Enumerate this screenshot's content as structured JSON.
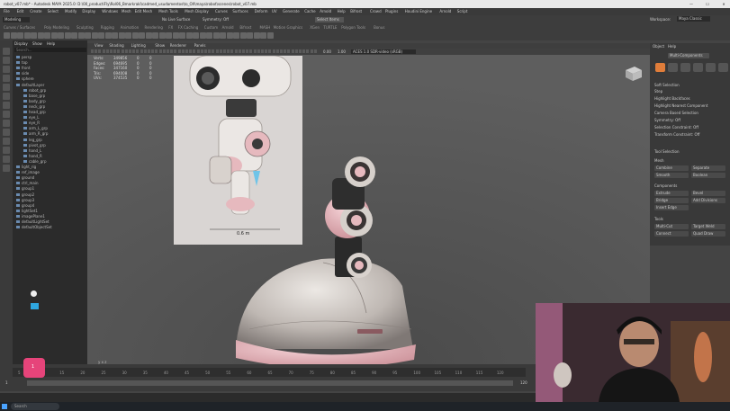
{
  "window": {
    "title": "robot_v07.mb* - Autodesk MAYA 2025.0: D:\\00_productiFly\\Rol06_Bmarkrakl\\cadmed_usudamentos\\to_OX\\maya\\robot\\scenes\\robot_v07.mb",
    "controls": [
      "—",
      "☐",
      "✕"
    ]
  },
  "menubar": {
    "items": [
      "File",
      "Edit",
      "Create",
      "Select",
      "Modify",
      "Display",
      "Windows",
      "Mesh",
      "Edit Mesh",
      "Mesh Tools",
      "Mesh Display",
      "Curves",
      "Surfaces",
      "Deform",
      "UV",
      "Generate",
      "Cache",
      "Arnold",
      "Help",
      "Bifrost",
      "Crowd",
      "Plugins",
      "Houdini Engine",
      "Arnold",
      "Script"
    ]
  },
  "shelf": {
    "modeling_dropdown": "Modeling",
    "workspace_label": "Workspace:",
    "workspace_value": "Maya Classic",
    "tabs": [
      "Curves / Surfaces",
      "Poly Modeling",
      "Sculpting",
      "Rigging",
      "Animation",
      "Rendering",
      "FX",
      "FX Caching",
      "Custom",
      "Arnold",
      "Bifrost",
      "MASH",
      "Motion Graphics",
      "XGen",
      "TURTLE",
      "Polygon Tools",
      "Bonus"
    ],
    "live_surface": "No Live Surface",
    "symmetry": "Symmetry: Off",
    "select_items": "Select Items"
  },
  "outliner": {
    "menus": [
      "Display",
      "Show",
      "Help"
    ],
    "search_placeholder": "Search...",
    "rows": [
      "persp",
      "top",
      "front",
      "side",
      "sphere",
      "defaultLayer",
      "robot_grp",
      "base_grp",
      "body_grp",
      "neck_grp",
      "head_grp",
      "eye_L",
      "eye_R",
      "arm_L_grp",
      "arm_R_grp",
      "leg_grp",
      "pivot_grp",
      "hand_L",
      "hand_R",
      "cable_grp",
      "light_rig",
      "ref_image",
      "ground",
      "ctrl_main",
      "group1",
      "group2",
      "group3",
      "group4",
      "lightSet1",
      "imagePlane1",
      "defaultLightSet",
      "defaultObjectSet"
    ]
  },
  "viewport": {
    "menus": [
      "View",
      "Shading",
      "Lighting",
      "Show",
      "Renderer",
      "Panels"
    ],
    "camera_label": "ACES 1.0 SDR-video (sRGB)",
    "exposure": "0.00",
    "gamma": "1.00",
    "stats": [
      {
        "label": "Verts:",
        "a": "349856",
        "b": "0",
        "c": "0"
      },
      {
        "label": "Edges:",
        "a": "694695",
        "b": "0",
        "c": "0"
      },
      {
        "label": "Faces:",
        "a": "347160",
        "b": "0",
        "c": "0"
      },
      {
        "label": "Tris:",
        "a": "694008",
        "b": "0",
        "c": "0"
      },
      {
        "label": "UVs:",
        "a": "374535",
        "b": "0",
        "c": "0"
      }
    ],
    "ref_caption": "0.6 m",
    "cube_label": "FRONT"
  },
  "attribute_panel": {
    "menus": [
      "Object",
      "Help"
    ],
    "header": "Multi-Components",
    "section_soft": "Soft Selection",
    "rows": [
      "Step",
      "Highlight Backfaces",
      "Highlight Nearest Component",
      "Camera Based Selection",
      "Symmetry: Off",
      "Selection Constraint: Off",
      "Transform Constraint: Off"
    ],
    "section_tool": "Tool Selection",
    "section_mesh": "Mesh",
    "mesh_buttons": [
      "Combine",
      "Separate",
      "Smooth",
      "Boolean"
    ],
    "section_components": "Components",
    "comp_buttons": [
      "Extrude",
      "Bevel",
      "Bridge",
      "Add Divisions",
      "Insert Edge"
    ],
    "section_tools": "Tools",
    "tool_buttons": [
      "Multi-Cut",
      "Target Weld",
      "Connect",
      "Quad Draw"
    ]
  },
  "timeline": {
    "current_frame": "1",
    "start": "1",
    "end": "120",
    "ticks": [
      "5",
      "10",
      "15",
      "20",
      "25",
      "30",
      "35",
      "40",
      "45",
      "50",
      "55",
      "60",
      "65",
      "70",
      "75",
      "80",
      "85",
      "90",
      "95",
      "100",
      "105",
      "110",
      "115",
      "120"
    ],
    "range_start": "1",
    "range_end": "120"
  },
  "taskbar": {
    "search_placeholder": "Search"
  },
  "colors": {
    "accent": "#e6447a",
    "viewport_bg": "#5a5a5a",
    "robot_pink": "#e9b2b8",
    "robot_white": "#d6d0cb"
  }
}
